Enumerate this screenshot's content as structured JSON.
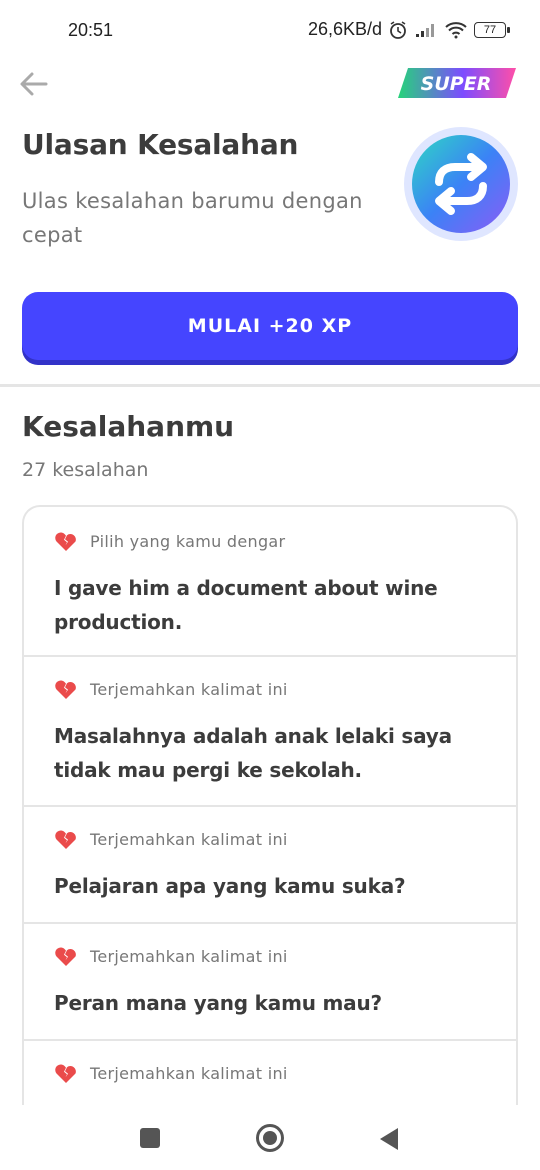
{
  "status_bar": {
    "time": "20:51",
    "network_speed": "26,6KB/d",
    "battery": "77",
    "icons": [
      "alarm-icon",
      "signal-icon",
      "wifi-icon",
      "battery-icon"
    ]
  },
  "top_nav": {
    "back_icon": "arrow-left-icon",
    "super_label": "SUPER"
  },
  "header": {
    "title": "Ulasan Kesalahan",
    "subtitle": "Ulas kesalahan barumu dengan cepat",
    "icon": "refresh-arrows-icon"
  },
  "start_button": {
    "label": "MULAI +20 XP"
  },
  "mistakes": {
    "title": "Kesalahanmu",
    "count": "27 kesalahan",
    "items": [
      {
        "type": "Pilih yang kamu dengar",
        "text": "I gave him a document about wine production."
      },
      {
        "type": "Terjemahkan kalimat ini",
        "text": "Masalahnya adalah anak lelaki saya tidak mau pergi ke sekolah."
      },
      {
        "type": "Terjemahkan kalimat ini",
        "text": "Pelajaran apa yang kamu suka?"
      },
      {
        "type": "Terjemahkan kalimat ini",
        "text": "Peran mana yang kamu mau?"
      },
      {
        "type": "Terjemahkan kalimat ini",
        "text": ""
      }
    ]
  },
  "colors": {
    "accent_blue": "#4545ff",
    "broken_heart_red": "#ea4b4b",
    "super_gradient": [
      "#26d37a",
      "#7d4cff",
      "#ff4fa8"
    ]
  }
}
